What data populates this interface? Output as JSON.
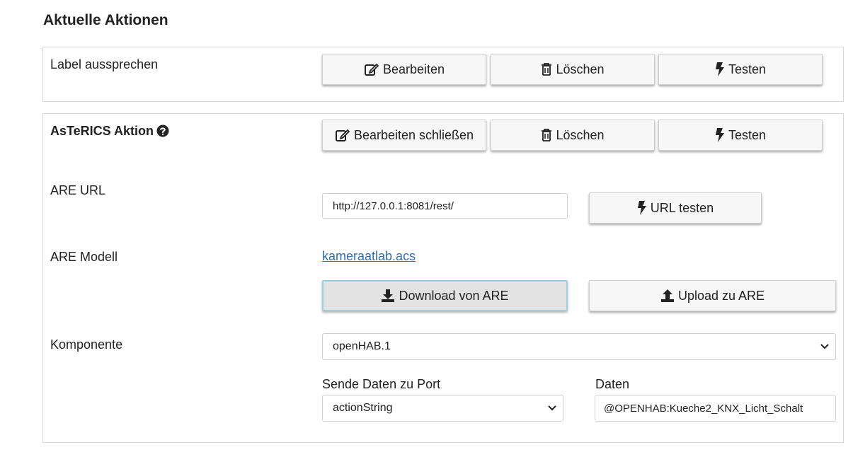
{
  "heading": "Aktuelle Aktionen",
  "action1": {
    "label": "Label aussprechen",
    "edit_button": "Bearbeiten",
    "delete_button": "Löschen",
    "test_button": "Testen"
  },
  "action2": {
    "title": "AsTeRICS Aktion",
    "close_edit_button": "Bearbeiten schließen",
    "delete_button": "Löschen",
    "test_button": "Testen",
    "are_url_label": "ARE URL",
    "are_url_value": "http://127.0.0.1:8081/rest/",
    "url_test_button": "URL testen",
    "are_model_label": "ARE Modell",
    "model_link": "kameraatlab.acs",
    "download_button": "Download von ARE",
    "upload_button": "Upload zu ARE",
    "component_label": "Komponente",
    "component_value": "openHAB.1",
    "port_label": "Sende Daten zu Port",
    "port_value": "actionString",
    "data_label": "Daten",
    "data_value": "@OPENHAB:Kueche2_KNX_Licht_Schalt"
  },
  "colors": {
    "link": "#2a6fb8",
    "active_border": "#9ccfe0"
  }
}
